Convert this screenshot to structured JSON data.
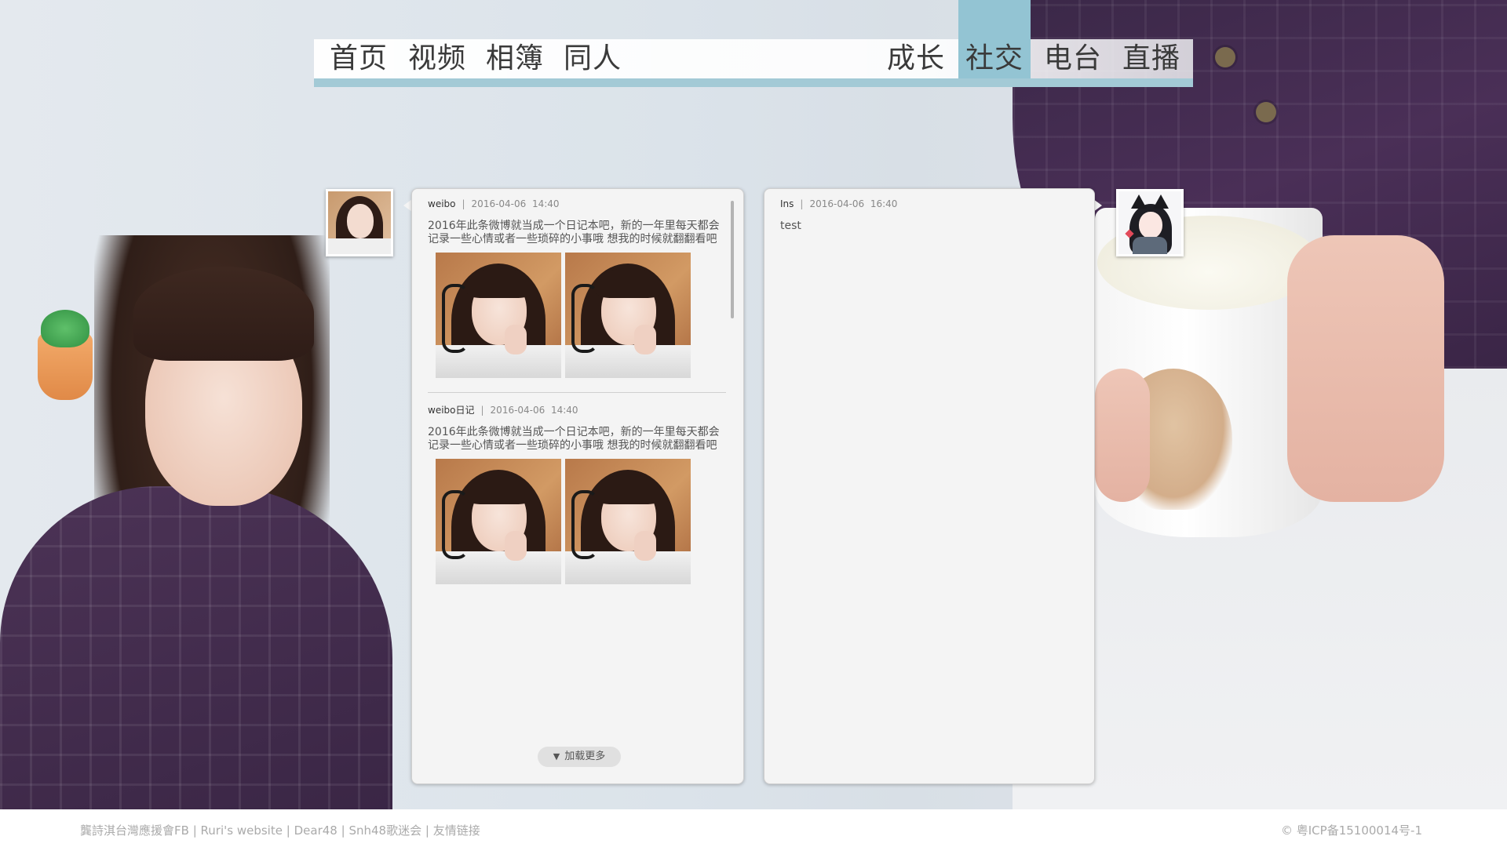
{
  "nav": {
    "left": [
      "首页",
      "视频",
      "相簿",
      "同人"
    ],
    "right": [
      "成长",
      "社交",
      "电台",
      "直播"
    ],
    "active": "社交",
    "active_color": "#93c4d3",
    "underline_color": "#a3cad6"
  },
  "left_panel": {
    "posts": [
      {
        "source": "weibo",
        "date": "2016-04-06",
        "time": "14:40",
        "text": "2016年此条微博就当成一个日记本吧，新的一年里每天都会记录一些心情或者一些琐碎的小事哦 想我的时候就翻翻看吧",
        "images": [
          "selfie-photo",
          "selfie-photo"
        ]
      },
      {
        "source": "weibo日记",
        "date": "2016-04-06",
        "time": "14:40",
        "text": "2016年此条微博就当成一个日记本吧，新的一年里每天都会记录一些心情或者一些琐碎的小事哦 想我的时候就翻翻看吧",
        "images": [
          "selfie-photo",
          "selfie-photo"
        ]
      }
    ],
    "load_more": "加载更多",
    "load_more_icon": "triangle-down-icon"
  },
  "right_panel": {
    "posts": [
      {
        "source": "Ins",
        "date": "2016-04-06",
        "time": "16:40",
        "text": "test"
      }
    ]
  },
  "footer": {
    "links": [
      "龔詩淇台灣應援會FB",
      "Ruri's website",
      "Dear48",
      "Snh48歌迷会",
      "友情链接"
    ],
    "separator": "|",
    "copyright": "© 粤ICP备15100014号-1"
  }
}
